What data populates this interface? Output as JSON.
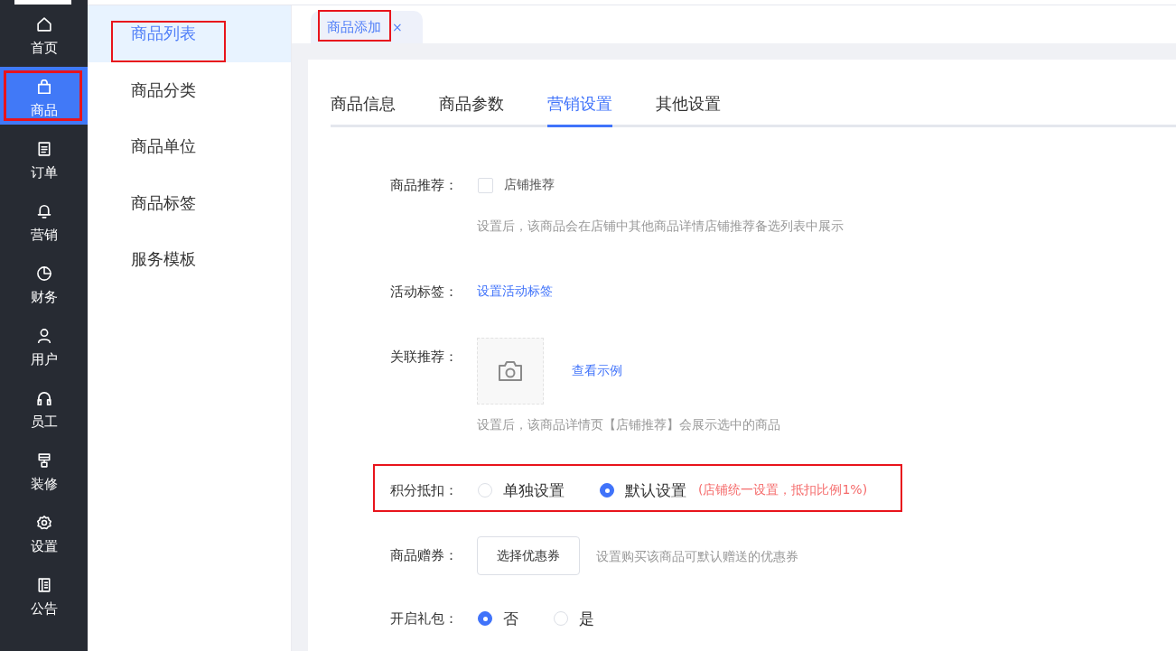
{
  "nav": {
    "items": [
      {
        "label": "首页",
        "selected": false,
        "highlighted": false
      },
      {
        "label": "商品",
        "selected": true,
        "highlighted": true
      },
      {
        "label": "订单",
        "selected": false,
        "highlighted": false
      },
      {
        "label": "营销",
        "selected": false,
        "highlighted": false
      },
      {
        "label": "财务",
        "selected": false,
        "highlighted": false
      },
      {
        "label": "用户",
        "selected": false,
        "highlighted": false
      },
      {
        "label": "员工",
        "selected": false,
        "highlighted": false
      },
      {
        "label": "装修",
        "selected": false,
        "highlighted": false
      },
      {
        "label": "设置",
        "selected": false,
        "highlighted": false
      },
      {
        "label": "公告",
        "selected": false,
        "highlighted": false
      }
    ]
  },
  "subnav": {
    "items": [
      {
        "label": "商品列表",
        "selected": true,
        "highlighted": true
      },
      {
        "label": "商品分类",
        "selected": false,
        "highlighted": false
      },
      {
        "label": "商品单位",
        "selected": false,
        "highlighted": false
      },
      {
        "label": "商品标签",
        "selected": false,
        "highlighted": false
      },
      {
        "label": "服务模板",
        "selected": false,
        "highlighted": false
      }
    ]
  },
  "page_tabs": [
    {
      "label": "商品添加",
      "close": "×",
      "selected": true,
      "highlighted": true
    }
  ],
  "form_tabs": [
    {
      "label": "商品信息",
      "selected": false
    },
    {
      "label": "商品参数",
      "selected": false
    },
    {
      "label": "营销设置",
      "selected": true
    },
    {
      "label": "其他设置",
      "selected": false
    }
  ],
  "form": {
    "rows": [
      {
        "kind": "checkbox",
        "label": "商品推荐：",
        "option": "店铺推荐",
        "checked": false,
        "hint": "设置后，该商品会在店铺中其他商品详情店铺推荐备选列表中展示",
        "highlighted": false
      },
      {
        "kind": "link",
        "label": "活动标签：",
        "link": "设置活动标签",
        "highlighted": false
      },
      {
        "kind": "upload",
        "label": "关联推荐：",
        "link": "查看示例",
        "hint": "设置后，该商品详情页【店铺推荐】会展示选中的商品",
        "highlighted": false
      },
      {
        "kind": "radio",
        "label": "积分抵扣：",
        "options": [
          {
            "label": "单独设置",
            "selected": false
          },
          {
            "label": "默认设置",
            "selected": true
          }
        ],
        "note": "(店铺统一设置，抵扣比例1%)",
        "highlighted": true
      },
      {
        "kind": "button",
        "label": "商品赠券：",
        "button": "选择优惠券",
        "hint": "设置购买该商品可默认赠送的优惠券",
        "highlighted": false
      },
      {
        "kind": "radio",
        "label": "开启礼包：",
        "options": [
          {
            "label": "否",
            "selected": true
          },
          {
            "label": "是",
            "selected": false
          }
        ],
        "highlighted": false
      }
    ]
  }
}
